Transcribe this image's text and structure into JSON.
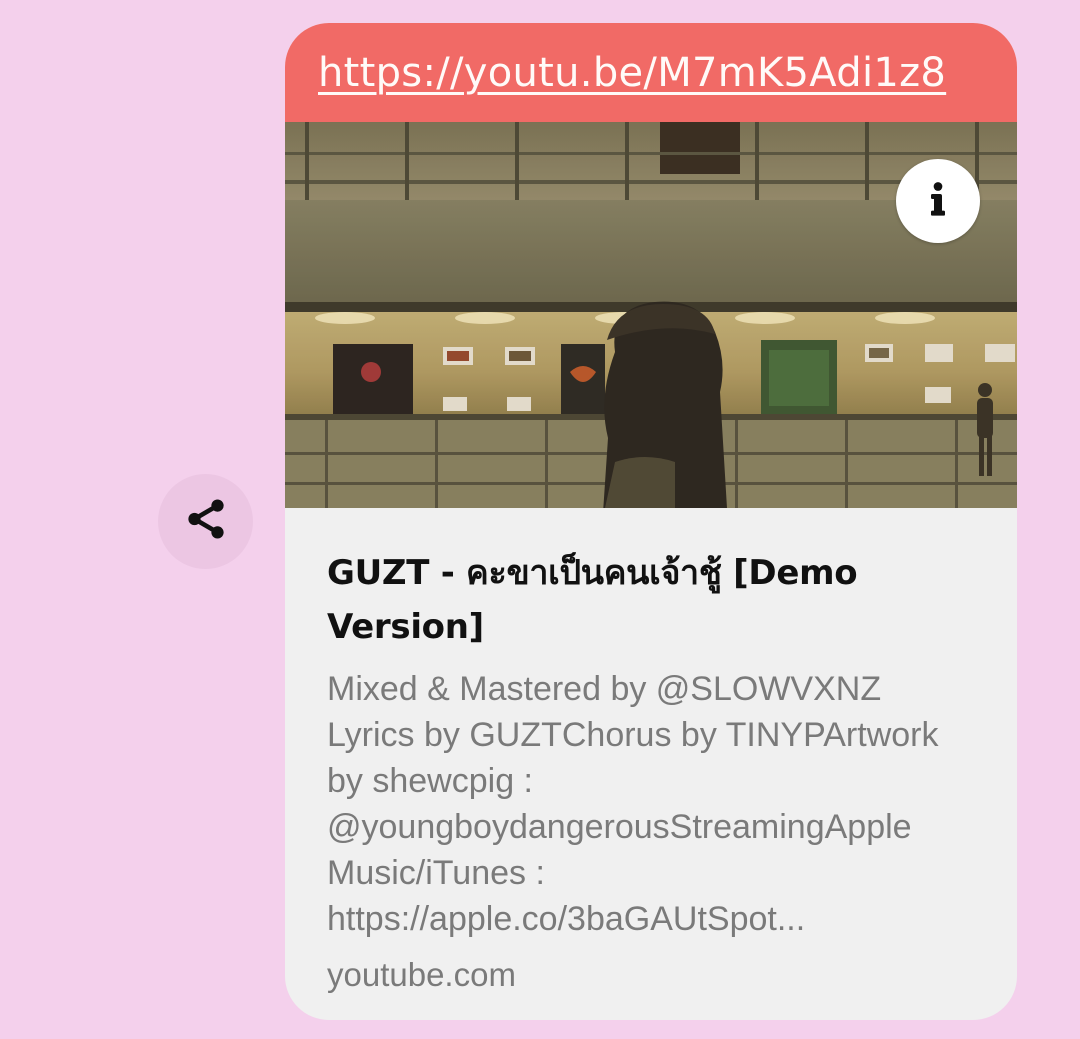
{
  "share": {
    "icon": "share-icon"
  },
  "link_preview": {
    "url": "https://youtu.be/M7mK5Adi1z8",
    "info_icon": "info-icon",
    "title": "GUZT - คะขาเป็นคนเจ้าชู้ [Demo Version]",
    "description": "Mixed & Mastered by @SLOWVXNZ\nLyrics by GUZTChorus by TINYPArtwork\nby shewcpig :\n@youngboydangerousStreamingApple\nMusic/iTunes :\nhttps://apple.co/3baGAUtSpot...",
    "domain": "youtube.com"
  },
  "colors": {
    "background": "#f4d0ec",
    "share_button_bg": "#ecc6e3",
    "header_bg": "#f16a66",
    "card_bg": "#f0f0f0"
  }
}
